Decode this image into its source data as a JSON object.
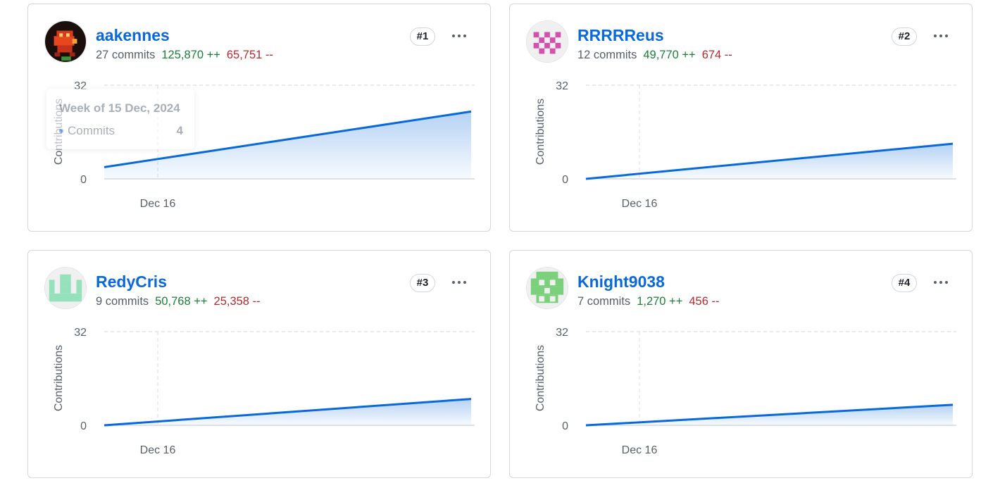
{
  "chart_common": {
    "ylabel": "Contributions",
    "y_ticks": [
      "32",
      "0"
    ],
    "x_tick": "Dec 16",
    "ylim": [
      0,
      32
    ],
    "line_color": "#0969da"
  },
  "contributors": [
    {
      "username": "aakennes",
      "commits": "27 commits",
      "additions": "125,870 ++",
      "deletions": "65,751 --",
      "rank": "#1",
      "avatar_icon": "pixel-character-avatar-icon",
      "chart_data": {
        "type": "area",
        "x": [
          "start",
          "end"
        ],
        "values": [
          4,
          23
        ],
        "ylim": [
          0,
          32
        ]
      }
    },
    {
      "username": "RRRRReus",
      "commits": "12 commits",
      "additions": "49,770 ++",
      "deletions": "674 --",
      "rank": "#2",
      "avatar_icon": "pink-identicon-avatar-icon",
      "avatar_color": "#d44fae",
      "chart_data": {
        "type": "area",
        "x": [
          "start",
          "end"
        ],
        "values": [
          0,
          12
        ],
        "ylim": [
          0,
          32
        ]
      }
    },
    {
      "username": "RedyCris",
      "commits": "9 commits",
      "additions": "50,768 ++",
      "deletions": "25,358 --",
      "rank": "#3",
      "avatar_icon": "mint-identicon-avatar-icon",
      "avatar_color": "#94e1bb",
      "chart_data": {
        "type": "area",
        "x": [
          "start",
          "end"
        ],
        "values": [
          0,
          9
        ],
        "ylim": [
          0,
          32
        ]
      }
    },
    {
      "username": "Knight9038",
      "commits": "7 commits",
      "additions": "1,270 ++",
      "deletions": "456 --",
      "rank": "#4",
      "avatar_icon": "green-identicon-avatar-icon",
      "avatar_color": "#7bd07b",
      "chart_data": {
        "type": "area",
        "x": [
          "start",
          "end"
        ],
        "values": [
          0,
          7
        ],
        "ylim": [
          0,
          32
        ]
      }
    }
  ],
  "tooltip": {
    "title": "Week of 15 Dec, 2024",
    "label": "Commits",
    "value": "4"
  }
}
